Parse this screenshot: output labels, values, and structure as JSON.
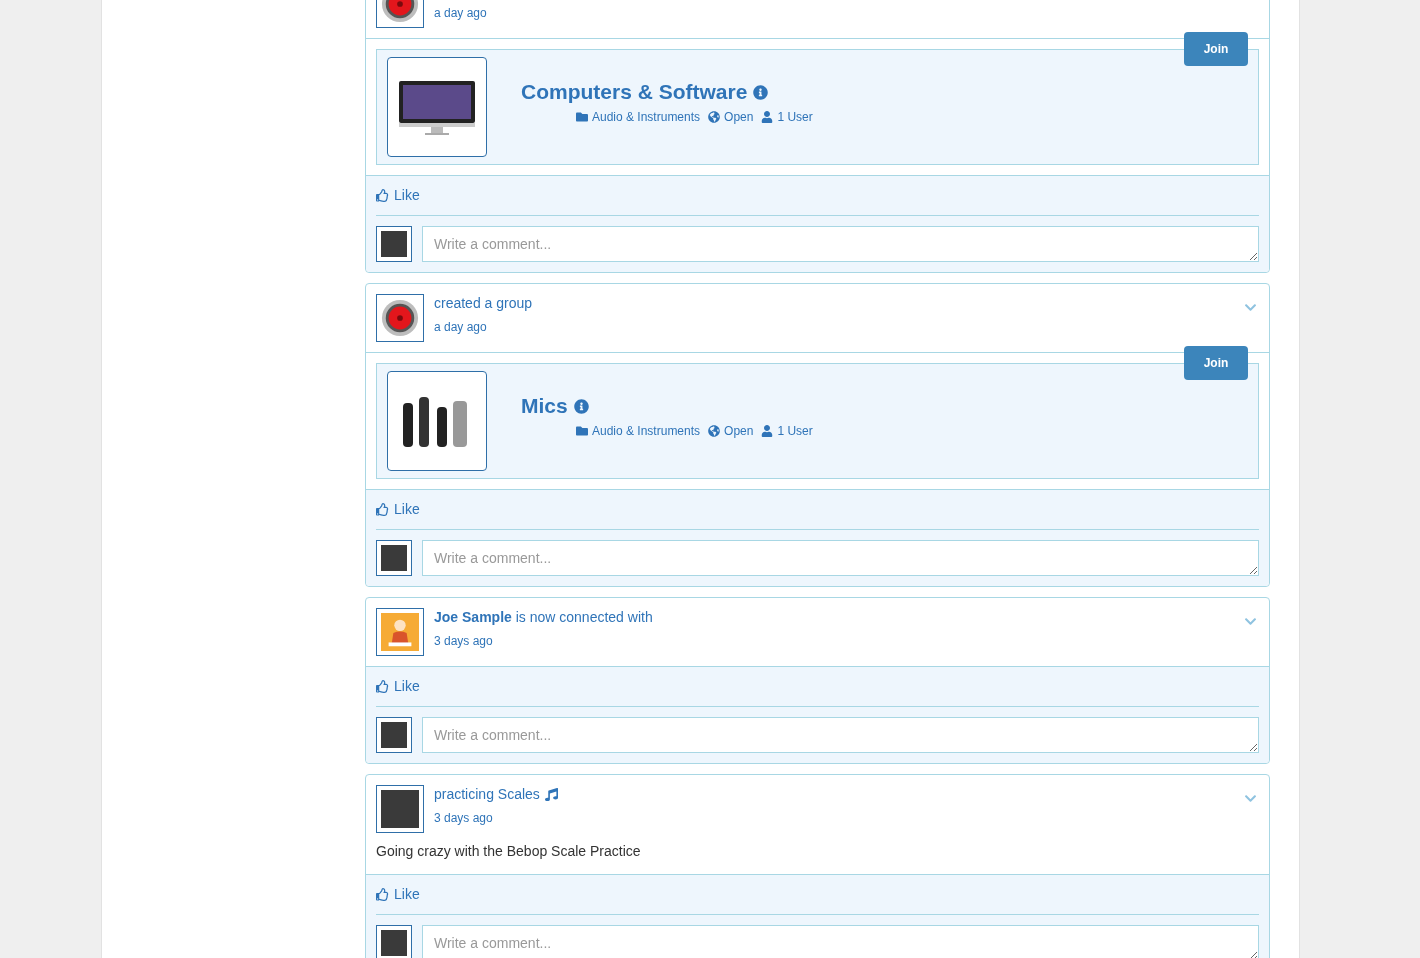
{
  "feed": [
    {
      "kind": "group_created",
      "time": "a day ago",
      "group": {
        "name": "Computers & Software",
        "category": "Audio & Instruments",
        "privacy": "Open",
        "members": "1 User",
        "join": "Join"
      },
      "like": "Like",
      "comment_placeholder": "Write a comment..."
    },
    {
      "kind": "group_created",
      "title": "created a group",
      "time": "a day ago",
      "group": {
        "name": "Mics",
        "category": "Audio & Instruments",
        "privacy": "Open",
        "members": "1 User",
        "join": "Join"
      },
      "like": "Like",
      "comment_placeholder": "Write a comment..."
    },
    {
      "kind": "connection",
      "title": "**Joe Sample** is now connected with",
      "time": "3 days ago",
      "like": "Like",
      "comment_placeholder": "Write a comment..."
    },
    {
      "kind": "status",
      "title": "practicing Scales",
      "time": "3 days ago",
      "body": "Going crazy with the Bebop Scale Practice",
      "like": "Like",
      "comment_placeholder": "Write a comment..."
    }
  ]
}
